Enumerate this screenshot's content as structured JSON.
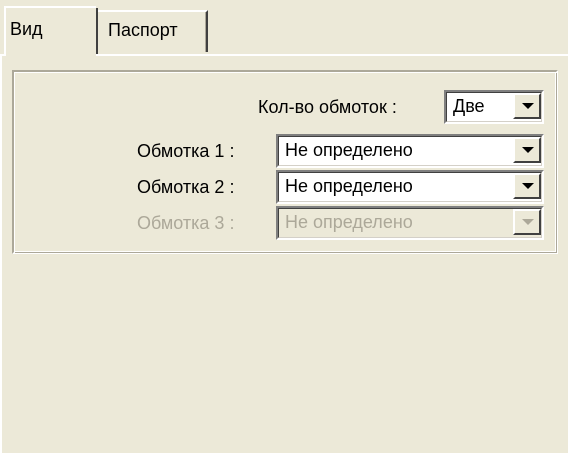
{
  "tabs": [
    {
      "label": "Вид",
      "active": true
    },
    {
      "label": "Паспорт",
      "active": false
    }
  ],
  "form": {
    "winding_count": {
      "label": "Кол-во обмоток :",
      "value": "Две"
    },
    "winding1": {
      "label": "Обмотка 1 :",
      "value": "Не определено",
      "enabled": true
    },
    "winding2": {
      "label": "Обмотка 2 :",
      "value": "Не определено",
      "enabled": true
    },
    "winding3": {
      "label": "Обмотка 3 :",
      "value": "Не определено",
      "enabled": false
    }
  },
  "icons": {
    "dropdown": "chevron-down-icon"
  },
  "colors": {
    "window_bg": "#ece9d8",
    "disabled_text": "#aca899",
    "field_bg": "#ffffff"
  }
}
